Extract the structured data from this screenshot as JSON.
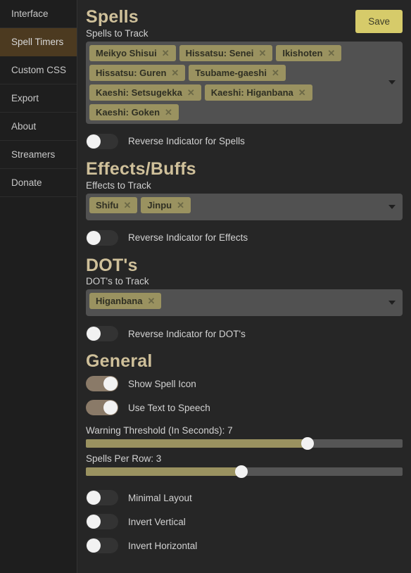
{
  "sidebar": {
    "items": [
      {
        "label": "Interface",
        "active": false
      },
      {
        "label": "Spell Timers",
        "active": true
      },
      {
        "label": "Custom CSS",
        "active": false
      },
      {
        "label": "Export",
        "active": false
      },
      {
        "label": "About",
        "active": false
      },
      {
        "label": "Streamers",
        "active": false
      },
      {
        "label": "Donate",
        "active": false
      }
    ]
  },
  "toolbar": {
    "save_label": "Save"
  },
  "spells": {
    "title": "Spells",
    "field_label": "Spells to Track",
    "tags": [
      "Meikyo Shisui",
      "Hissatsu: Senei",
      "Ikishoten",
      "Hissatsu: Guren",
      "Tsubame-gaeshi",
      "Kaeshi: Setsugekka",
      "Kaeshi: Higanbana",
      "Kaeshi: Goken"
    ],
    "reverse_label": "Reverse Indicator for Spells",
    "reverse_on": false
  },
  "effects": {
    "title": "Effects/Buffs",
    "field_label": "Effects to Track",
    "tags": [
      "Shifu",
      "Jinpu"
    ],
    "reverse_label": "Reverse Indicator for Effects",
    "reverse_on": false
  },
  "dots": {
    "title": "DOT's",
    "field_label": "DOT's to Track",
    "tags": [
      "Higanbana"
    ],
    "reverse_label": "Reverse Indicator for DOT's",
    "reverse_on": false
  },
  "general": {
    "title": "General",
    "toggles_top": [
      {
        "label": "Show Spell Icon",
        "on": true
      },
      {
        "label": "Use Text to Speech",
        "on": true
      }
    ],
    "warning_threshold": {
      "label": "Warning Threshold (In Seconds): 7",
      "value": 7,
      "percent": 70
    },
    "spells_per_row": {
      "label": "Spells Per Row: 3",
      "value": 3,
      "percent": 49
    },
    "toggles_bottom": [
      {
        "label": "Minimal Layout",
        "on": false
      },
      {
        "label": "Invert Vertical",
        "on": false
      },
      {
        "label": "Invert Horizontal",
        "on": false
      }
    ]
  },
  "icons": {
    "tag_remove": "✕",
    "dropdown_caret": "chevron-down-icon"
  },
  "colors": {
    "accent_gold": "#d6cb6a",
    "tag_olive": "#9a9260",
    "heading_tan": "#cfc09a",
    "sidebar_active": "#4c3a20",
    "toggle_on": "#8a7a68"
  }
}
